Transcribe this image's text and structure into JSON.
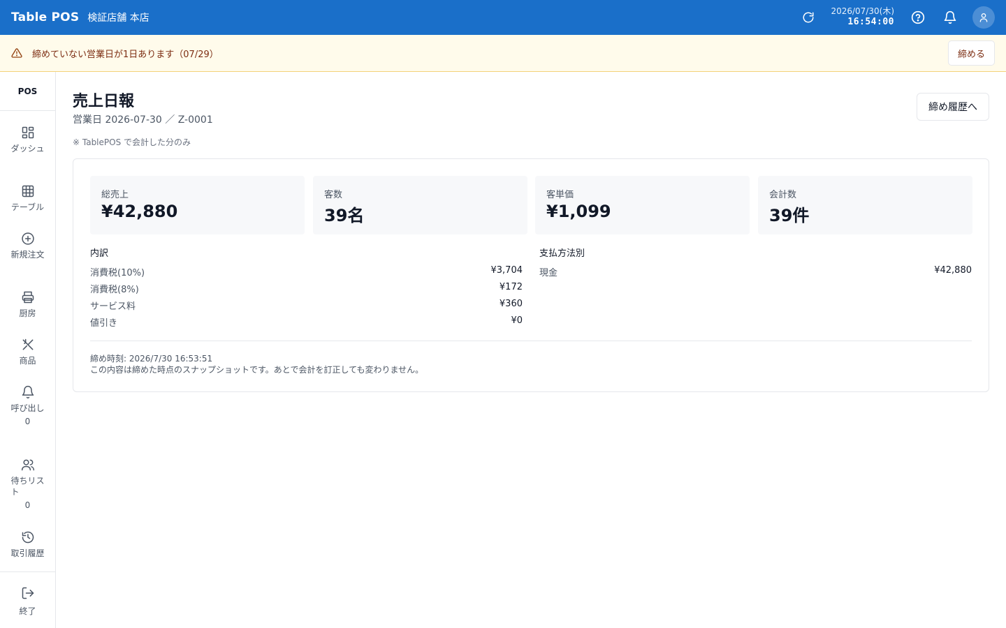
{
  "header": {
    "brand": "Table POS",
    "store": "検証店舗 本店",
    "date": "2026/07/30(木)",
    "time": "16:54:00"
  },
  "banner": {
    "text": "締めていない営業日が1日あります（07/29）",
    "button": "締める"
  },
  "sidebar": {
    "logo": "POS",
    "items": [
      {
        "label": "ダッシュ",
        "icon": "dashboard-icon"
      },
      {
        "label": "テーブル",
        "icon": "table-grid-icon"
      },
      {
        "label": "新規注文",
        "icon": "plus-circle-icon"
      },
      {
        "label": "厨房",
        "icon": "printer-icon"
      },
      {
        "label": "商品",
        "icon": "utensils-icon"
      },
      {
        "label": "呼び出し",
        "icon": "bell-icon",
        "count": "0"
      },
      {
        "label": "待ちリスト",
        "icon": "users-icon",
        "count": "0"
      },
      {
        "label": "取引履歴",
        "icon": "history-icon"
      }
    ],
    "logout": "終了"
  },
  "page": {
    "title": "売上日報",
    "subtitle": "営業日 2026-07-30 ／ Z-0001",
    "note": "※ TablePOS で会計した分のみ",
    "history_button": "締め履歴へ"
  },
  "stats": [
    {
      "label": "総売上",
      "value": "¥42,880"
    },
    {
      "label": "客数",
      "value": "39名"
    },
    {
      "label": "客単価",
      "value": "¥1,099"
    },
    {
      "label": "会計数",
      "value": "39件"
    }
  ],
  "breakdown": {
    "title": "内訳",
    "rows": [
      {
        "label": "消費税(10%)",
        "value": "¥3,704"
      },
      {
        "label": "消費税(8%)",
        "value": "¥172"
      },
      {
        "label": "サービス料",
        "value": "¥360"
      },
      {
        "label": "値引き",
        "value": "¥0"
      }
    ]
  },
  "payments": {
    "title": "支払方法別",
    "rows": [
      {
        "label": "現金",
        "value": "¥42,880"
      }
    ]
  },
  "footer": {
    "closed_at": "締め時刻: 2026/7/30 16:53:51",
    "snapshot_note": "この内容は締めた時点のスナップショットです。あとで会計を訂正しても変わりません。"
  },
  "colors": {
    "header_bg": "#1a6fc9",
    "banner_bg": "#fffbeb",
    "banner_text": "#7c2d12",
    "stat_bg": "#f7f8fa"
  }
}
